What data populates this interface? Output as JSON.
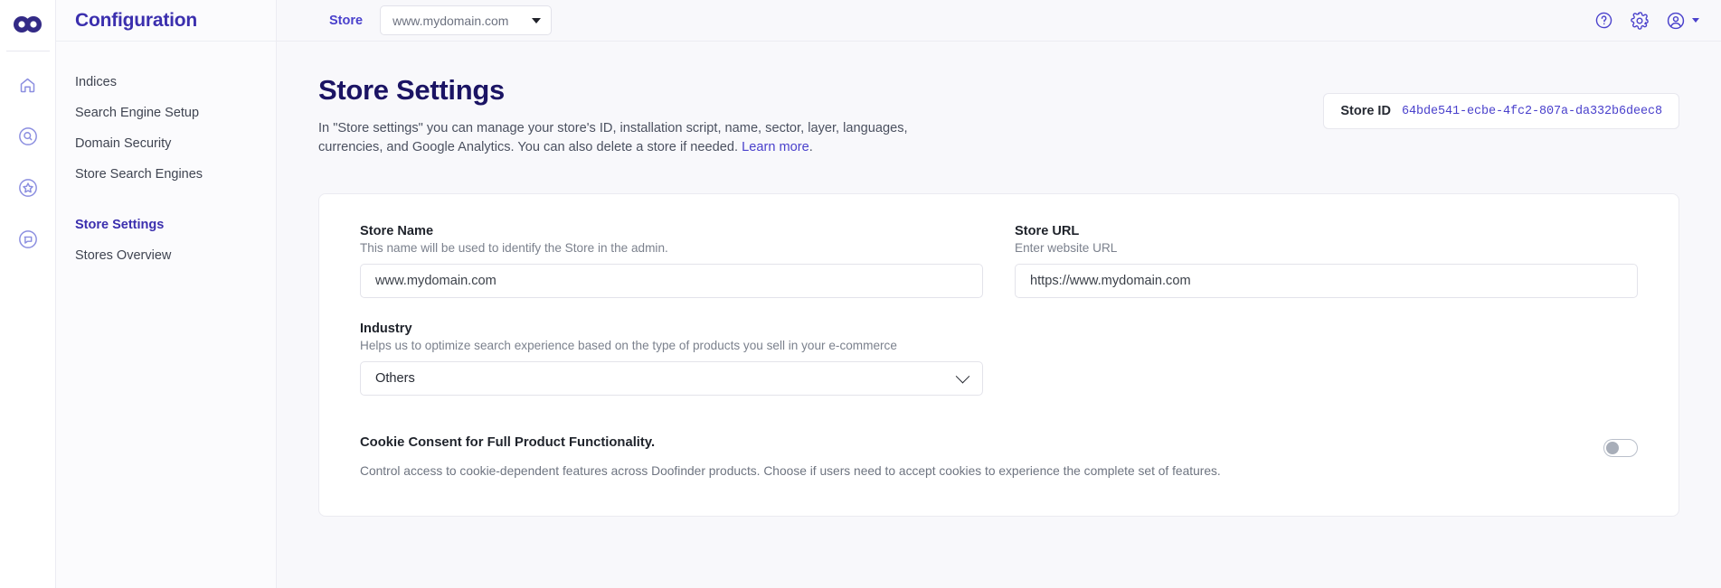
{
  "brand": {
    "logo_icon": "doofinder-infinity-logo",
    "logo_color": "#332a86"
  },
  "rail": {
    "items": [
      {
        "icon": "home-icon",
        "name": "home"
      },
      {
        "icon": "search-circle-icon",
        "name": "search"
      },
      {
        "icon": "star-circle-icon",
        "name": "favorites"
      },
      {
        "icon": "chat-circle-icon",
        "name": "messages"
      }
    ]
  },
  "sidebar": {
    "title": "Configuration",
    "items": [
      {
        "label": "Indices",
        "active": false
      },
      {
        "label": "Search Engine Setup",
        "active": false
      },
      {
        "label": "Domain Security",
        "active": false
      },
      {
        "label": "Store Search Engines",
        "active": false
      },
      {
        "label": "Store Settings",
        "active": true
      },
      {
        "label": "Stores Overview",
        "active": false
      }
    ]
  },
  "topbar": {
    "store_label": "Store",
    "store_selected": "www.mydomain.com",
    "help_icon": "question-circle-icon",
    "settings_icon": "gear-icon",
    "account_icon": "user-circle-icon"
  },
  "page": {
    "title": "Store Settings",
    "description": "In \"Store settings\" you can manage your store's ID, installation script, name, sector, layer, languages, currencies, and Google Analytics. You can also delete a store if needed. ",
    "learn_more": "Learn more",
    "description_end": ".",
    "store_id_label": "Store ID",
    "store_id_value": "64bde541-ecbe-4fc2-807a-da332b6deec8"
  },
  "form": {
    "store_name": {
      "label": "Store Name",
      "hint": "This name will be used to identify the Store in the admin.",
      "value": "www.mydomain.com",
      "placeholder": "www.mydomain.com"
    },
    "store_url": {
      "label": "Store URL",
      "hint": "Enter website URL",
      "value": "https://www.mydomain.com",
      "placeholder": "https://www.mydomain.com"
    },
    "industry": {
      "label": "Industry",
      "hint": "Helps us to optimize search experience based on the type of products you sell in your e-commerce",
      "selected": "Others"
    },
    "cookie_consent": {
      "title": "Cookie Consent for Full Product Functionality.",
      "description": "Control access to cookie-dependent features across Doofinder products. Choose if users need to accept cookies to experience the complete set of features.",
      "enabled": false
    }
  },
  "colors": {
    "primary": "#4a41cc",
    "title": "#1b1464",
    "page_bg": "#f8f8fb",
    "card_bg": "#ffffff",
    "border": "#e3e3ea"
  }
}
